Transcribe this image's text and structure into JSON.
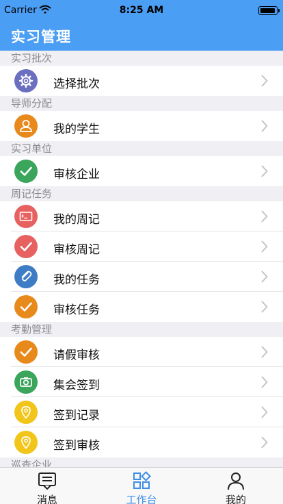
{
  "status": {
    "carrier": "Carrier",
    "time": "8:25 AM"
  },
  "nav": {
    "title": "实习管理"
  },
  "sections": [
    {
      "header": "实习批次",
      "items": [
        {
          "label": "选择批次",
          "icon": "gear-icon",
          "color": "#6b6fbf"
        }
      ]
    },
    {
      "header": "导师分配",
      "items": [
        {
          "label": "我的学生",
          "icon": "user-icon",
          "color": "#e8891c"
        }
      ]
    },
    {
      "header": "实习单位",
      "items": [
        {
          "label": "审核企业",
          "icon": "check-icon",
          "color": "#3aa55b"
        }
      ]
    },
    {
      "header": "周记任务",
      "items": [
        {
          "label": "我的周记",
          "icon": "terminal-icon",
          "color": "#e86161"
        },
        {
          "label": "审核周记",
          "icon": "check-icon",
          "color": "#e86161"
        },
        {
          "label": "我的任务",
          "icon": "paperclip-icon",
          "color": "#3f7cc6"
        },
        {
          "label": "审核任务",
          "icon": "check-icon",
          "color": "#e8891c"
        }
      ]
    },
    {
      "header": "考勤管理",
      "items": [
        {
          "label": "请假审核",
          "icon": "check-icon",
          "color": "#e8891c"
        },
        {
          "label": "集会签到",
          "icon": "camera-icon",
          "color": "#3aa55b"
        },
        {
          "label": "签到记录",
          "icon": "location-pin-icon",
          "color": "#f2c51a"
        },
        {
          "label": "签到审核",
          "icon": "location-pin-icon",
          "color": "#f2c51a"
        }
      ]
    },
    {
      "header": "巡查企业",
      "items": []
    }
  ],
  "tabbar": {
    "tabs": [
      {
        "label": "消息",
        "icon": "message-icon",
        "active": false
      },
      {
        "label": "工作台",
        "icon": "workbench-icon",
        "active": true
      },
      {
        "label": "我的",
        "icon": "profile-icon",
        "active": false
      }
    ],
    "active_color": "#3d8de8"
  }
}
